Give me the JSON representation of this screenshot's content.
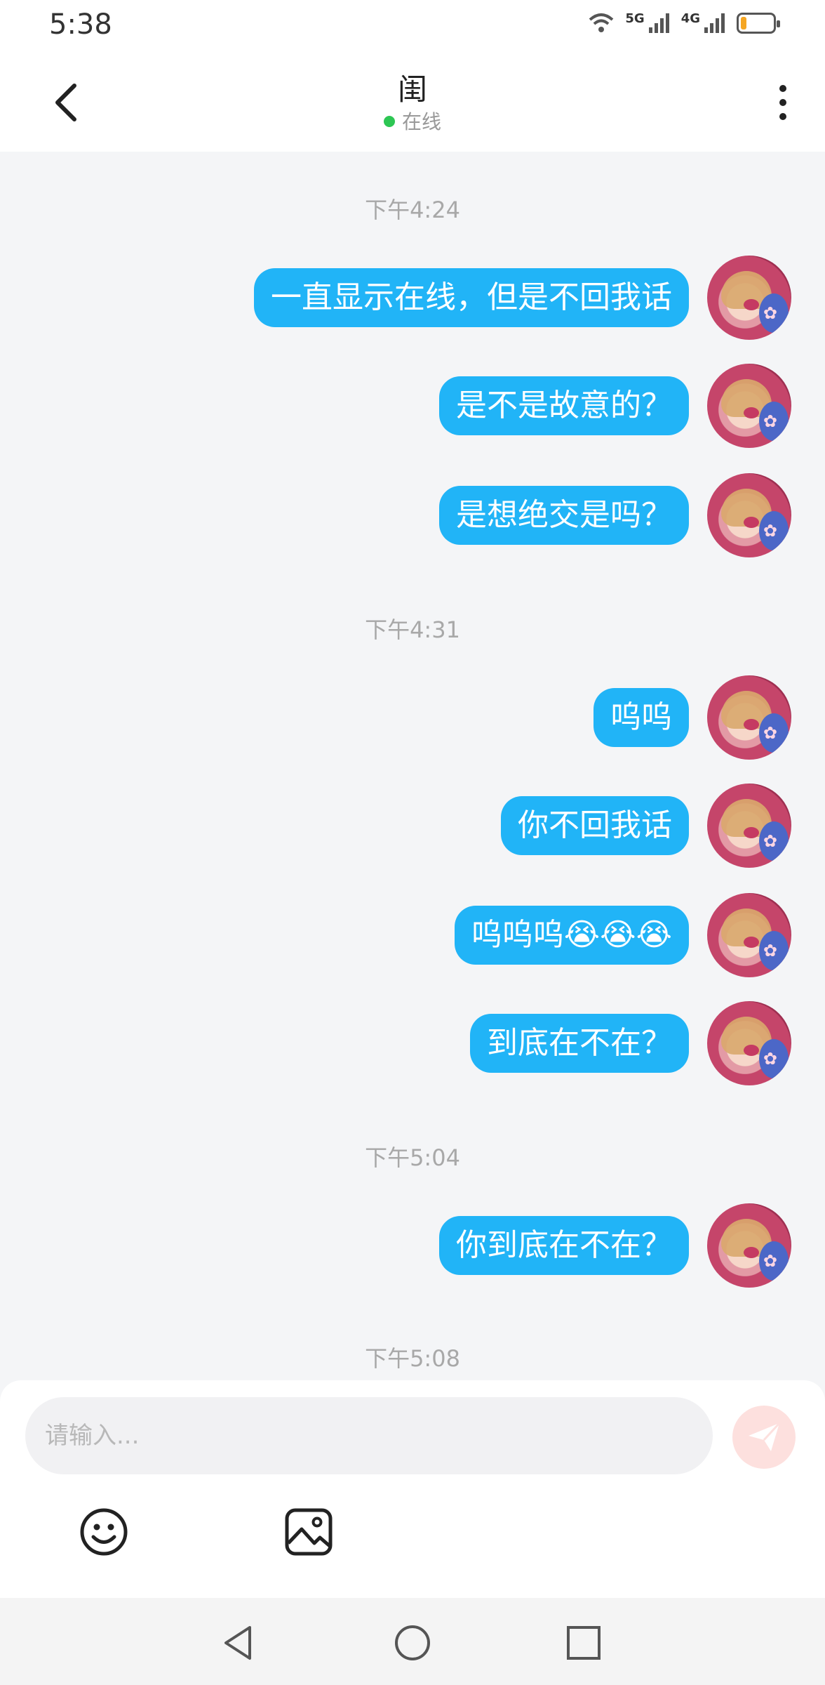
{
  "status_bar": {
    "time": "5:38",
    "network_1": "5G",
    "network_2": "4G",
    "battery_level": 0.15,
    "battery_color": "#f5a623"
  },
  "header": {
    "title": "闺",
    "status": "在线",
    "status_color": "#2dc653",
    "back_icon": "chevron-left-icon",
    "more_icon": "vertical-dots-icon"
  },
  "messages": [
    {
      "timestamp": "下午4:24"
    },
    {
      "text": "一直显示在线，但是不回我话"
    },
    {
      "text": "是不是故意的？"
    },
    {
      "text": "是想绝交是吗？"
    },
    {
      "timestamp": "下午4:31"
    },
    {
      "text": "呜呜"
    },
    {
      "text": "你不回我话"
    },
    {
      "text": "呜呜呜😭😭😭"
    },
    {
      "text": "到底在不在？"
    },
    {
      "timestamp": "下午5:04"
    },
    {
      "text": "你到底在不在？"
    },
    {
      "timestamp": "下午5:08"
    }
  ],
  "bubble_color": "#21b4f7",
  "composer": {
    "placeholder": "请输入...",
    "send_icon": "paper-plane-icon",
    "tools": [
      "smiley-icon",
      "image-icon"
    ]
  },
  "nav_bar": [
    "back-triangle-icon",
    "home-circle-icon",
    "recents-square-icon"
  ]
}
